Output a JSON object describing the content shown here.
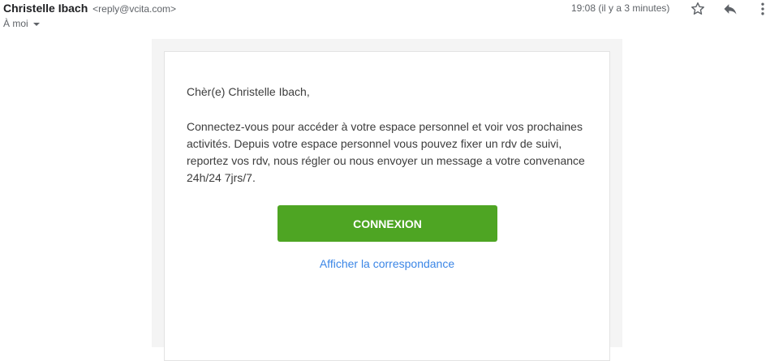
{
  "header": {
    "sender_name": "Christelle Ibach",
    "sender_email": "<reply@vcita.com>",
    "to_label": "À moi",
    "timestamp": "19:08 (il y a 3 minutes)",
    "icons": {
      "star": "star-outline-icon",
      "reply": "reply-icon",
      "more": "more-vertical-icon"
    }
  },
  "email": {
    "greeting": "Chèr(e) Christelle Ibach,",
    "body": "Connectez-vous pour accéder à votre espace personnel et voir vos prochaines activités. Depuis votre espace personnel vous pouvez fixer un rdv de suivi, reportez vos rdv, nous régler ou nous envoyer un message a votre convenance 24h/24 7jrs/7.",
    "cta_label": "CONNEXION",
    "link_label": "Afficher la correspondance"
  },
  "colors": {
    "cta": "#4ea523",
    "link": "#3b86e6",
    "outer_bg": "#f4f4f4"
  }
}
